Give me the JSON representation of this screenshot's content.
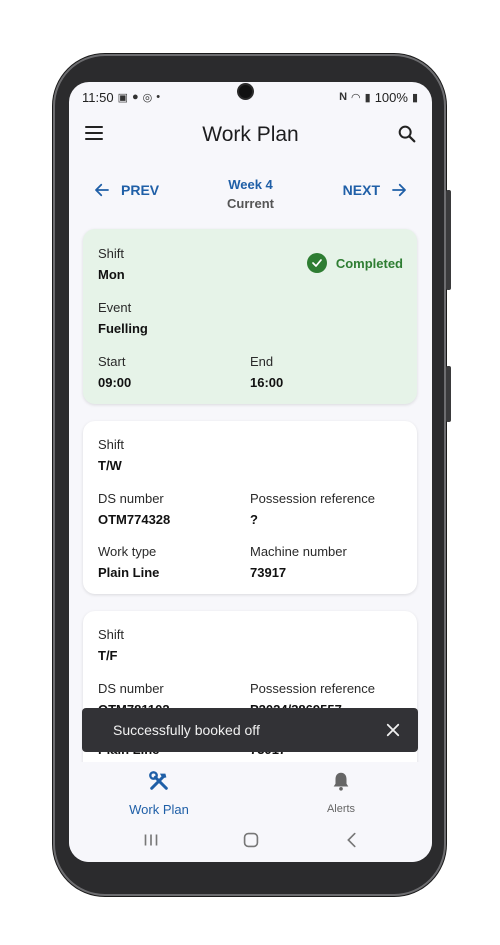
{
  "status_bar": {
    "time": "11:50",
    "battery": "100%"
  },
  "app_bar": {
    "title": "Work Plan"
  },
  "week_nav": {
    "prev_label": "PREV",
    "next_label": "NEXT",
    "week": "Week 4",
    "period": "Current"
  },
  "cards": [
    {
      "status": "Completed",
      "shift_label": "Shift",
      "shift_value": "Mon",
      "event_label": "Event",
      "event_value": "Fuelling",
      "start_label": "Start",
      "start_value": "09:00",
      "end_label": "End",
      "end_value": "16:00"
    },
    {
      "shift_label": "Shift",
      "shift_value": "T/W",
      "ds_label": "DS number",
      "ds_value": "OTM774328",
      "poss_label": "Possession reference",
      "poss_value": "?",
      "work_label": "Work type",
      "work_value": "Plain Line",
      "machine_label": "Machine number",
      "machine_value": "73917"
    },
    {
      "shift_label": "Shift",
      "shift_value": "T/F",
      "ds_label": "DS number",
      "ds_value": "OTM781102",
      "poss_label": "Possession reference",
      "poss_value": "P2024/3869557",
      "work_value": "Plain Line",
      "machine_value": "73917"
    }
  ],
  "snackbar": {
    "message": "Successfully booked off"
  },
  "bottom_nav": {
    "tab1": "Work Plan",
    "tab2": "Alerts"
  },
  "colors": {
    "accent": "#1f5fa7",
    "success": "#2e7d32",
    "completed_card": "#e6f3e8"
  }
}
